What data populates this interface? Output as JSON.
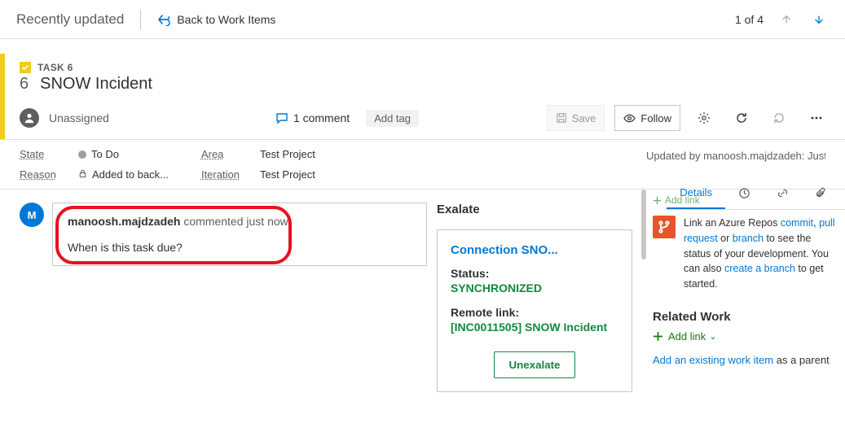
{
  "topbar": {
    "title": "Recently updated",
    "back_label": "Back to Work Items",
    "pager_text": "1 of 4"
  },
  "work_item": {
    "type_label": "TASK 6",
    "id": "6",
    "title": "SNOW Incident",
    "assignee": "Unassigned",
    "assignee_initials": "",
    "comment_count": "1 comment",
    "add_tag_label": "Add tag"
  },
  "actions": {
    "save_label": "Save",
    "follow_label": "Follow"
  },
  "fields": {
    "state_label": "State",
    "state_value": "To Do",
    "reason_label": "Reason",
    "reason_value": "Added to back...",
    "area_label": "Area",
    "area_value": "Test Project",
    "iteration_label": "Iteration",
    "iteration_value": "Test Project",
    "updated_text": "Updated by manoosh.majdzadeh: Just now"
  },
  "right_tabs": {
    "details_label": "Details"
  },
  "discussion": {
    "avatar_initial": "M",
    "author": "manoosh.majdzadeh",
    "meta": "commented just now",
    "body": "When is this task due?"
  },
  "exalate": {
    "section_title": "Exalate",
    "connection": "Connection SNO...",
    "status_label": "Status:",
    "status_value": "SYNCHRONIZED",
    "remote_link_label": "Remote link:",
    "remote_link_value": "[INC0011505] SNOW Incident",
    "button_label": "Unexalate"
  },
  "dev": {
    "add_link_mini": "Add link",
    "text_pre": "Link an Azure Repos ",
    "commit": "commit",
    "sep1": ", ",
    "pull_request": "pull request",
    "sep2": " or ",
    "branch": "branch",
    "text_mid": " to see the status of your development. You can also ",
    "create_branch": "create a branch",
    "text_post": " to get started."
  },
  "related": {
    "title": "Related Work",
    "add_link": "Add link",
    "chevron": "⌄",
    "add_existing_link": "Add an existing work item",
    "add_existing_suffix": " as a parent"
  }
}
